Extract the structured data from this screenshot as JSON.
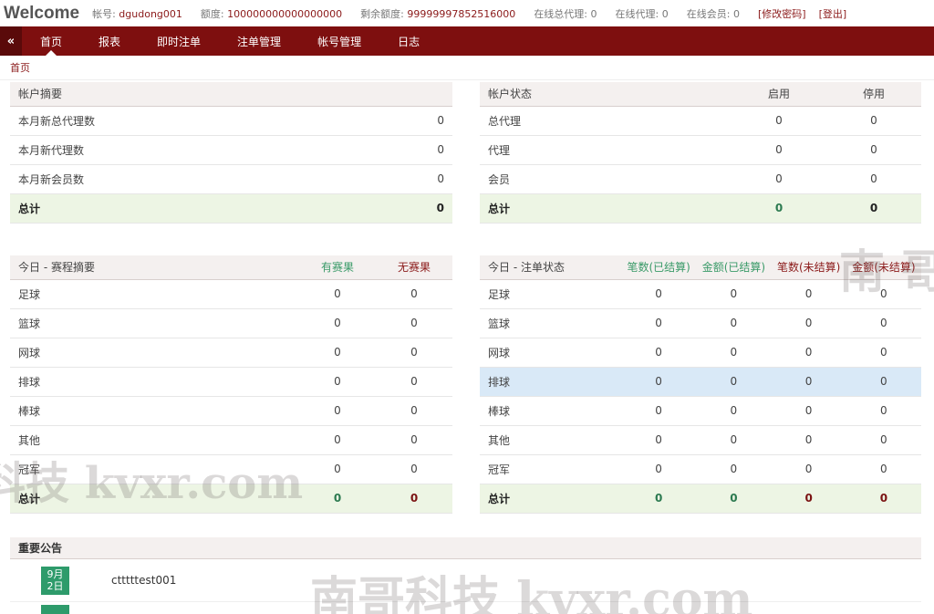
{
  "header": {
    "welcome": "Welcome",
    "account_label": "帐号:",
    "account_value": "dgudong001",
    "credit_label": "额度:",
    "credit_value": "100000000000000000",
    "remaining_label": "剩余额度:",
    "remaining_value": "99999997852516000",
    "online_master_label": "在线总代理:",
    "online_master_value": "0",
    "online_agent_label": "在线代理:",
    "online_agent_value": "0",
    "online_member_label": "在线会员:",
    "online_member_value": "0",
    "change_password": "[修改密码]",
    "logout": "[登出]"
  },
  "nav": {
    "collapse": "«",
    "items": [
      "首页",
      "报表",
      "即时注单",
      "注单管理",
      "帐号管理",
      "日志"
    ]
  },
  "breadcrumb": "首页",
  "account_summary": {
    "title": "帐户摘要",
    "rows": [
      {
        "label": "本月新总代理数",
        "value": "0"
      },
      {
        "label": "本月新代理数",
        "value": "0"
      },
      {
        "label": "本月新会员数",
        "value": "0"
      }
    ],
    "total": {
      "label": "总计",
      "value": "0"
    }
  },
  "account_status": {
    "title": "帐户状态",
    "col_enabled": "启用",
    "col_disabled": "停用",
    "rows": [
      {
        "label": "总代理",
        "enabled": "0",
        "disabled": "0"
      },
      {
        "label": "代理",
        "enabled": "0",
        "disabled": "0"
      },
      {
        "label": "会员",
        "enabled": "0",
        "disabled": "0"
      }
    ],
    "total": {
      "label": "总计",
      "enabled": "0",
      "disabled": "0"
    }
  },
  "today_matches": {
    "title": "今日 - 赛程摘要",
    "col_with": "有赛果",
    "col_without": "无赛果",
    "rows": [
      {
        "label": "足球",
        "with": "0",
        "without": "0"
      },
      {
        "label": "篮球",
        "with": "0",
        "without": "0"
      },
      {
        "label": "网球",
        "with": "0",
        "without": "0"
      },
      {
        "label": "排球",
        "with": "0",
        "without": "0"
      },
      {
        "label": "棒球",
        "with": "0",
        "without": "0"
      },
      {
        "label": "其他",
        "with": "0",
        "without": "0"
      },
      {
        "label": "冠军",
        "with": "0",
        "without": "0"
      }
    ],
    "total": {
      "label": "总计",
      "with": "0",
      "without": "0"
    }
  },
  "today_bets": {
    "title": "今日 - 注单状态",
    "col_count_settled": "笔数(已结算)",
    "col_amount_settled": "金额(已结算)",
    "col_count_unsettled": "笔数(未结算)",
    "col_amount_unsettled": "金额(未结算)",
    "rows": [
      {
        "label": "足球",
        "v1": "0",
        "v2": "0",
        "v3": "0",
        "v4": "0"
      },
      {
        "label": "篮球",
        "v1": "0",
        "v2": "0",
        "v3": "0",
        "v4": "0"
      },
      {
        "label": "网球",
        "v1": "0",
        "v2": "0",
        "v3": "0",
        "v4": "0"
      },
      {
        "label": "排球",
        "v1": "0",
        "v2": "0",
        "v3": "0",
        "v4": "0"
      },
      {
        "label": "棒球",
        "v1": "0",
        "v2": "0",
        "v3": "0",
        "v4": "0"
      },
      {
        "label": "其他",
        "v1": "0",
        "v2": "0",
        "v3": "0",
        "v4": "0"
      },
      {
        "label": "冠军",
        "v1": "0",
        "v2": "0",
        "v3": "0",
        "v4": "0"
      }
    ],
    "total": {
      "label": "总计",
      "v1": "0",
      "v2": "0",
      "v3": "0",
      "v4": "0"
    }
  },
  "notices": {
    "title": "重要公告",
    "items": [
      {
        "month": "9月",
        "day": "2日",
        "title": "ctttttest001"
      }
    ]
  },
  "watermark": {
    "text_mid": "科技 kvxr.com",
    "text_bottom": "南哥科技 kvxr.com",
    "text_right": "南 哥"
  },
  "colors": {
    "brand": "#7e0f0f",
    "green": "#3a9a68",
    "total_bg": "#edf5e4",
    "highlight_bg": "#d9e9f7"
  }
}
